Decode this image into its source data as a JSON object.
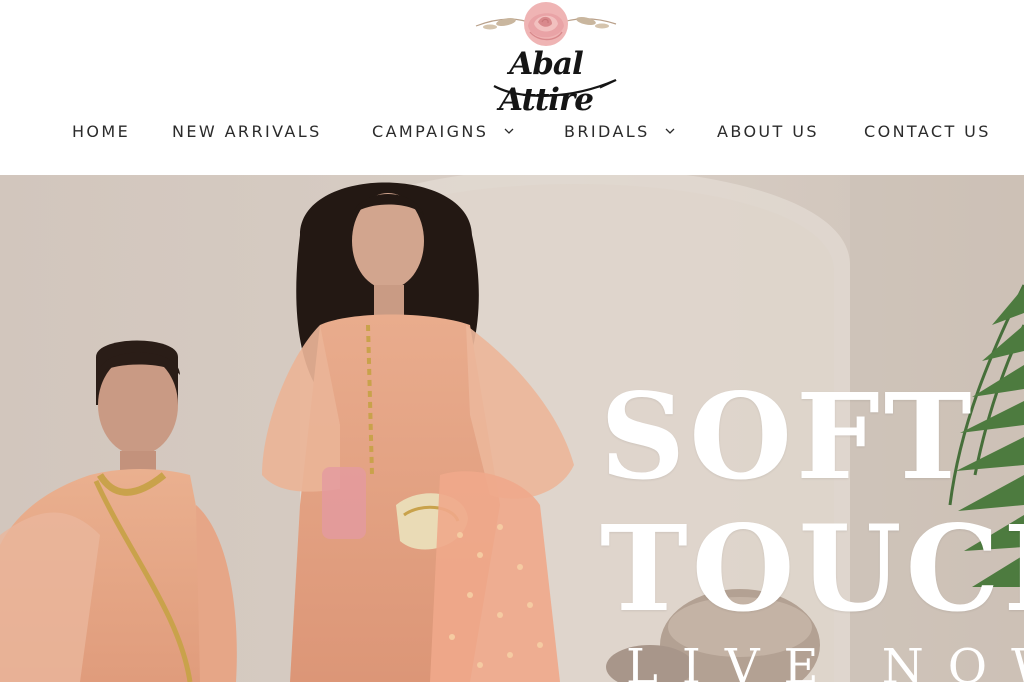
{
  "brand": {
    "name": "Abal Attire",
    "icon": "rose-icon",
    "colors": {
      "rose": "#e9a3a6",
      "rose_dark": "#c97679",
      "text": "#151515"
    }
  },
  "nav": {
    "items": [
      {
        "label": "HOME",
        "has_dropdown": false
      },
      {
        "label": "NEW ARRIVALS",
        "has_dropdown": false
      },
      {
        "label": "CAMPAIGNS",
        "has_dropdown": true
      },
      {
        "label": "BRIDALS",
        "has_dropdown": true
      },
      {
        "label": "ABOUT US",
        "has_dropdown": false
      },
      {
        "label": "CONTACT US",
        "has_dropdown": false
      }
    ]
  },
  "hero": {
    "headline_line1": "SOFT",
    "headline_line2": "TOUCH",
    "subline": "LIVE NOW",
    "colors": {
      "background": "#d6cbc2",
      "outfit": "#e8a889",
      "text": "#ffffff"
    }
  }
}
